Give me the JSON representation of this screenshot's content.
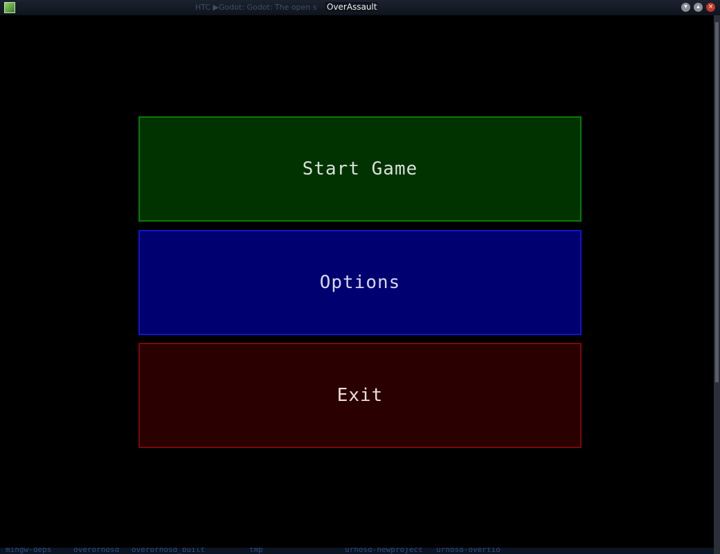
{
  "window": {
    "title": "OverAssault",
    "behind_title": "HTC ▶Godot: Godot: The open s"
  },
  "menu": {
    "start_label": "Start Game",
    "options_label": "Options",
    "exit_label": "Exit"
  },
  "background_labels": [
    "mingw-deps",
    "overorhosd",
    "overorhosd_built",
    "tmp",
    "urhosd-newproject",
    "urhosd-overtio"
  ],
  "colors": {
    "start_fill": "#003300",
    "options_fill": "#000070",
    "exit_fill": "#2a0000"
  },
  "icons": {
    "minimize": "chevron-down-icon",
    "maximize": "chevron-up-icon",
    "close": "close-icon"
  }
}
